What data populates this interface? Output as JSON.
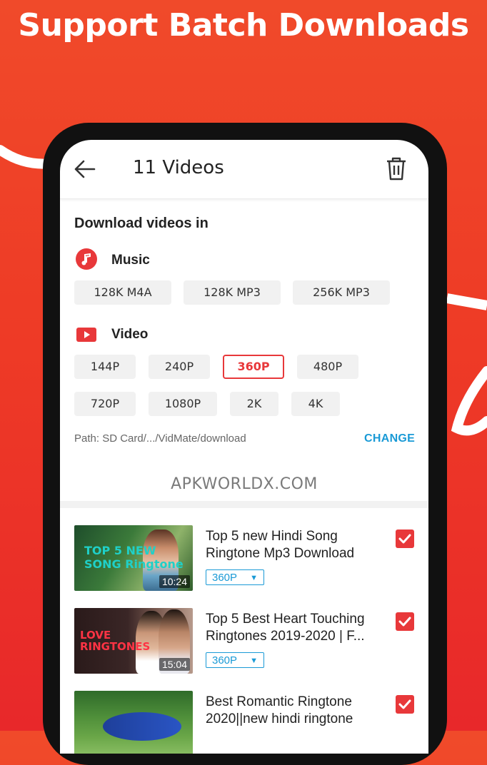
{
  "headline": "Support Batch Downloads",
  "header": {
    "title": "11 Videos"
  },
  "download": {
    "section_title": "Download videos in",
    "music_label": "Music",
    "music_options": [
      "128K  M4A",
      "128K  MP3",
      "256K  MP3"
    ],
    "video_label": "Video",
    "video_options": [
      "144P",
      "240P",
      "360P",
      "480P",
      "720P",
      "1080P",
      "2K",
      "4K"
    ],
    "selected_video": "360P",
    "path": "Path: SD Card/.../VidMate/download",
    "change_label": "CHANGE"
  },
  "watermark": "APKWORLDX.COM",
  "videos": [
    {
      "title": "Top 5 new Hindi Song Ringtone Mp3 Download",
      "duration": "10:24",
      "quality": "360P",
      "checked": true,
      "thumb_text": "TOP 5 NEW SONG Ringtone"
    },
    {
      "title": "Top 5 Best Heart Touching Ringtones 2019-2020 | F...",
      "duration": "15:04",
      "quality": "360P",
      "checked": true,
      "thumb_text": "LOVE RINGTONES"
    },
    {
      "title": "Best Romantic Ringtone 2020||new hindi ringtone",
      "duration": "",
      "quality": "",
      "checked": true,
      "thumb_text": ""
    }
  ],
  "colors": {
    "accent_red": "#e8383a",
    "link_blue": "#1a9ad6",
    "background": "#ee3b26"
  }
}
